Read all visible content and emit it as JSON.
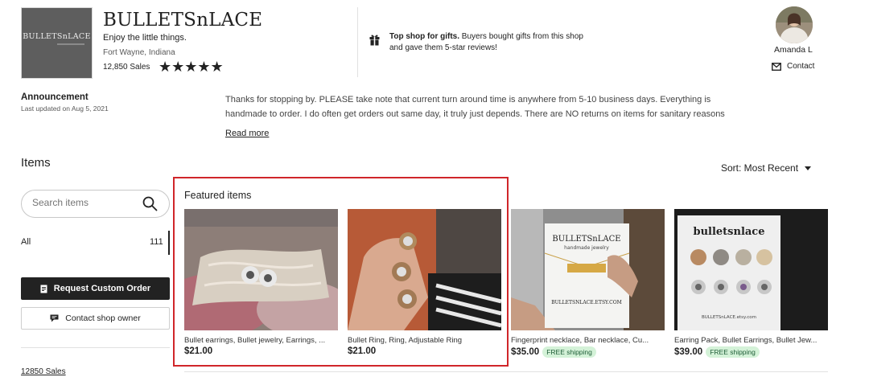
{
  "shop": {
    "logo_text": "BULLETSnLACE",
    "name": "BULLETSnLACE",
    "tagline": "Enjoy the little things.",
    "location": "Fort Wayne, Indiana",
    "sales": "12,850 Sales",
    "rating_stars": "★★★★★",
    "rating": 5
  },
  "gift_notice": {
    "bold": "Top shop for gifts.",
    "line1_rest": " Buyers bought gifts from this shop",
    "line2": "and gave them 5-star reviews!"
  },
  "owner": {
    "name": "Amanda L",
    "contact_label": "Contact"
  },
  "announcement": {
    "title": "Announcement",
    "updated": "Last updated on Aug 5, 2021",
    "line1": "Thanks for stopping by. PLEASE take note that current turn around time is anywhere from 5-10 business days. Everything is",
    "line2": "handmade to order. I do often get orders out same day, it truly just depends. There are NO returns on items for sanitary reasons",
    "read_more": "Read more"
  },
  "items": {
    "title": "Items",
    "sort_label": "Sort: Most Recent",
    "search_placeholder": "Search items",
    "categories": [
      {
        "label": "All",
        "count": "111"
      }
    ],
    "request_custom_order": "Request Custom Order",
    "contact_shop_owner": "Contact shop owner",
    "sales_link": "12850 Sales"
  },
  "featured": {
    "title": "Featured items",
    "cards": [
      {
        "title": "Bullet earrings, Bullet jewelry, Earrings, ...",
        "price": "$21.00",
        "badge": ""
      },
      {
        "title": "Bullet Ring, Ring, Adjustable Ring",
        "price": "$21.00",
        "badge": ""
      },
      {
        "title": "Fingerprint necklace, Bar necklace, Cu...",
        "price": "$35.00",
        "badge": "FREE shipping"
      },
      {
        "title": "Earring Pack, Bullet Earrings, Bullet Jew...",
        "price": "$39.00",
        "badge": "FREE shipping"
      }
    ],
    "card3_image_text": [
      "BULLETSnLACE",
      "handmade jewelry",
      "BULLETSNLACE.ETSY.COM"
    ],
    "card4_image_text": [
      "bulletsnlace",
      "BULLETSnLACE.etsy.com"
    ]
  },
  "colors": {
    "highlight_border": "#d0262a",
    "dark_button": "#222222",
    "free_shipping_bg": "#d4f2d8",
    "free_shipping_text": "#1e5d37"
  }
}
